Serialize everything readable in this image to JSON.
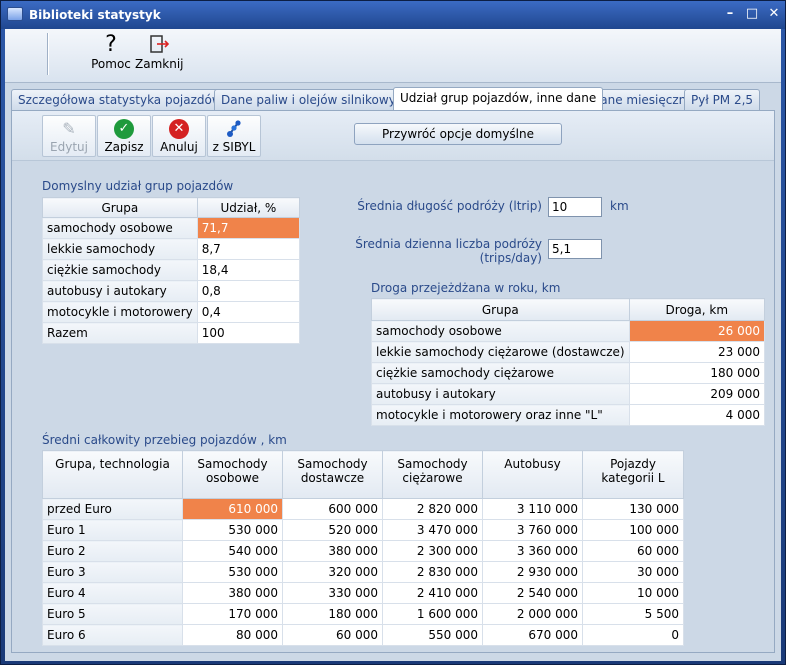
{
  "window": {
    "title": "Biblioteki statystyk"
  },
  "toolbar": {
    "help_label": "Pomoc",
    "close_label": "Zamknij"
  },
  "tabs": [
    {
      "label": "Szczegółowa statystyka pojazdów"
    },
    {
      "label": "Dane paliw i olejów silnikowych"
    },
    {
      "label": "Udział grup pojazdów, inne dane"
    },
    {
      "label": "Dane miesięczne"
    },
    {
      "label": "Pył PM 2,5"
    }
  ],
  "actions": {
    "edit_label": "Edytuj",
    "save_label": "Zapisz",
    "cancel_label": "Anuluj",
    "sibyl_label": "z SIBYL",
    "reset_label": "Przywróć opcje domyślne"
  },
  "share": {
    "title": "Domyslny udział grup pojazdów",
    "headers": [
      "Grupa",
      "Udział, %"
    ],
    "rows": [
      [
        "samochody osobowe",
        "71,7"
      ],
      [
        "lekkie samochody",
        "8,7"
      ],
      [
        "ciężkie samochody",
        "18,4"
      ],
      [
        "autobusy i autokary",
        "0,8"
      ],
      [
        "motocykle i motorowery",
        "0,4"
      ],
      [
        "Razem",
        "100"
      ]
    ]
  },
  "trip": {
    "length_label": "Średnia długość podróży  (ltrip)",
    "length_value": "10",
    "length_unit": "km",
    "count_label_1": "Średnia dzienna liczba podróży",
    "count_label_2": "(trips/day)",
    "count_value": "5,1"
  },
  "distance": {
    "title": "Droga przejeżdżana w roku, km",
    "headers": [
      "Grupa",
      "Droga, km"
    ],
    "rows": [
      [
        "samochody osobowe",
        "26 000"
      ],
      [
        "lekkie samochody ciężarowe (dostawcze)",
        "23 000"
      ],
      [
        "ciężkie samochody ciężarowe",
        "180 000"
      ],
      [
        "autobusy i autokary",
        "209 000"
      ],
      [
        "motocykle i motorowery oraz inne \"L\"",
        "4 000"
      ]
    ]
  },
  "mileage": {
    "title": "Średni całkowity przebieg pojazdów , km",
    "headers": [
      "Grupa, technologia",
      "Samochody osobowe",
      "Samochody dostawcze",
      "Samochody ciężarowe",
      "Autobusy",
      "Pojazdy kategorii L"
    ],
    "rows": [
      [
        "przed Euro",
        "610 000",
        "600 000",
        "2 820 000",
        "3 110 000",
        "130 000"
      ],
      [
        "Euro 1",
        "530 000",
        "520 000",
        "3 470 000",
        "3 760 000",
        "100 000"
      ],
      [
        "Euro 2",
        "540 000",
        "380 000",
        "2 300 000",
        "3 360 000",
        "60 000"
      ],
      [
        "Euro 3",
        "530 000",
        "320 000",
        "2 830 000",
        "2 930 000",
        "30 000"
      ],
      [
        "Euro 4",
        "380 000",
        "330 000",
        "2 410 000",
        "2 540 000",
        "10 000"
      ],
      [
        "Euro 5",
        "170 000",
        "180 000",
        "1 600 000",
        "2 000 000",
        "5 500"
      ],
      [
        "Euro 6",
        "80 000",
        "60 000",
        "550 000",
        "670 000",
        "0"
      ]
    ]
  },
  "colors": {
    "selection": "#f0834a",
    "accent": "#2a4a8a"
  }
}
